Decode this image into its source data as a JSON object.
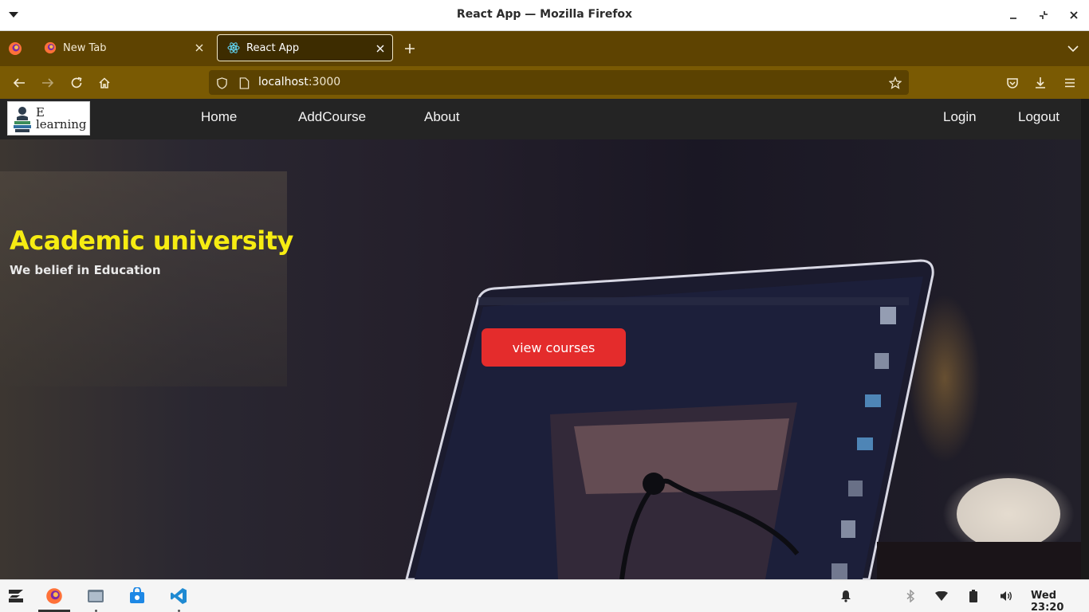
{
  "window": {
    "title": "React App — Mozilla Firefox"
  },
  "tabs": [
    {
      "label": "New Tab",
      "active": false,
      "icon": "firefox-icon"
    },
    {
      "label": "React App",
      "active": true,
      "icon": "react-icon"
    }
  ],
  "urlbar": {
    "host": "localhost",
    "port": ":3000"
  },
  "site": {
    "logo_line1": "E",
    "logo_line2": "learning",
    "nav_left": [
      "Home",
      "AddCourse",
      "About"
    ],
    "nav_right": [
      "Login",
      "Logout"
    ]
  },
  "hero": {
    "title": "Academic university",
    "subtitle": "We belief in Education",
    "button_label": "view courses"
  },
  "taskbar": {
    "clock": "Wed 23:20"
  },
  "colors": {
    "tab_strip": "#5e4301",
    "toolbar": "#7a5a03",
    "hero_title": "#f6ec12",
    "hero_button": "#e42c2c",
    "site_nav": "#242424"
  }
}
